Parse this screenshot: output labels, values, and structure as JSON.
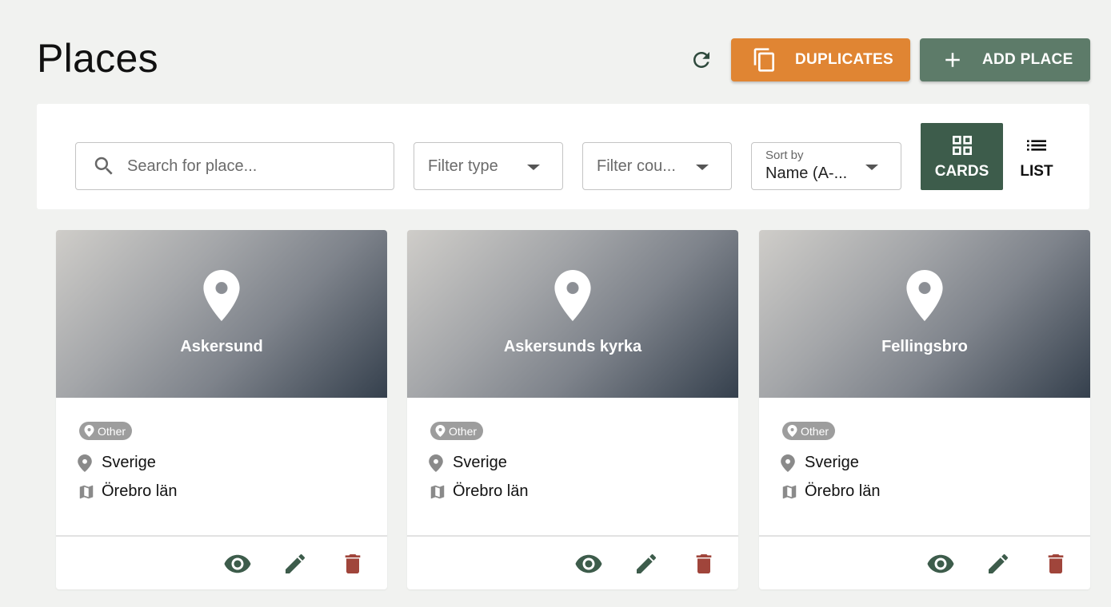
{
  "page": {
    "title": "Places"
  },
  "header": {
    "refresh_icon": "refresh-icon",
    "duplicates_label": "DUPLICATES",
    "duplicates_icon": "copy-icon",
    "add_label": "ADD PLACE",
    "add_icon": "plus-icon"
  },
  "toolbar": {
    "search": {
      "placeholder": "Search for place...",
      "icon": "search-icon"
    },
    "filter_type": {
      "placeholder": "Filter type"
    },
    "filter_country": {
      "placeholder": "Filter cou..."
    },
    "sort": {
      "label": "Sort by",
      "value": "Name (A-..."
    },
    "view": {
      "cards_label": "CARDS",
      "list_label": "LIST",
      "active": "CARDS"
    }
  },
  "colors": {
    "duplicates": "#e08533",
    "add_place": "#5d7b69",
    "active_view": "#3d5c4b",
    "action_icon": "#3d5c4b",
    "delete_icon": "#a0453b",
    "chip": "#9d9d9d"
  },
  "cards": [
    {
      "title": "Askersund",
      "type": "Other",
      "country": "Sverige",
      "region": "Örebro län"
    },
    {
      "title": "Askersunds kyrka",
      "type": "Other",
      "country": "Sverige",
      "region": "Örebro län"
    },
    {
      "title": "Fellingsbro",
      "type": "Other",
      "country": "Sverige",
      "region": "Örebro län"
    }
  ]
}
